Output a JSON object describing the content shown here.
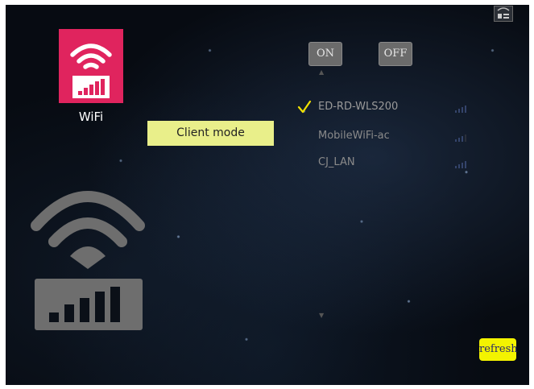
{
  "mode_tile": {
    "label": "WiFi",
    "icon": "wifi-icon"
  },
  "client_mode": {
    "label": "Client mode"
  },
  "power": {
    "on_label": "ON",
    "off_label": "OFF"
  },
  "networks": [
    {
      "ssid": "ED-RD-WLS200",
      "connected": true,
      "signal_icon": "signal-strength-icon"
    },
    {
      "ssid": "MobileWiFi-ac",
      "connected": false,
      "signal_icon": "signal-strength-icon"
    },
    {
      "ssid": "CJ_LAN",
      "connected": false,
      "signal_icon": "signal-strength-icon"
    }
  ],
  "refresh": {
    "label": "refresh"
  },
  "colors": {
    "tile": "#e0245e",
    "client_mode": "#e9ef8a",
    "check": "#f0e000",
    "refresh": "#f3f300",
    "signal_dark": "#6e6e6e",
    "signal_light": "#8a8a8a"
  }
}
